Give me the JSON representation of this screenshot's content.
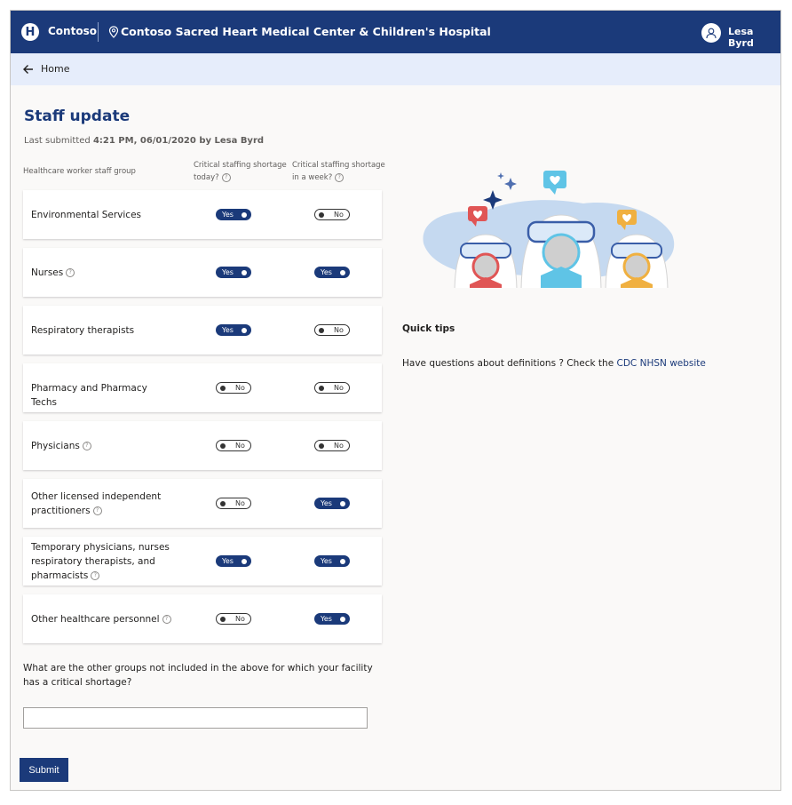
{
  "header": {
    "logo_letter": "H",
    "brand": "Contoso",
    "hospital": "Contoso Sacred Heart Medical Center & Children's Hospital",
    "user": "Lesa Byrd"
  },
  "subnav": {
    "home_label": "Home"
  },
  "page": {
    "title": "Staff update",
    "last_submitted_prefix": "Last submitted ",
    "last_submitted_value": "4:21 PM, 06/01/2020 by Lesa Byrd"
  },
  "columns": {
    "group": "Healthcare worker staff group",
    "today_line1": "Critical staffing shortage",
    "today_line2": "today?",
    "week_line1": "Critical staffing shortage",
    "week_line2": "in a week?"
  },
  "toggle_labels": {
    "on": "Yes",
    "off": "No"
  },
  "rows": [
    {
      "lines": [
        "Environmental Services"
      ],
      "help": false,
      "today": true,
      "week": false
    },
    {
      "lines": [
        "Nurses"
      ],
      "help": true,
      "today": true,
      "week": true
    },
    {
      "lines": [
        "Respiratory therapists"
      ],
      "help": false,
      "today": true,
      "week": false
    },
    {
      "lines": [
        "Pharmacy and Pharmacy Techs"
      ],
      "help": false,
      "today": false,
      "week": false
    },
    {
      "lines": [
        "Physicians"
      ],
      "help": true,
      "today": false,
      "week": false
    },
    {
      "lines": [
        "Other licensed independent",
        "practitioners"
      ],
      "help": true,
      "today": false,
      "week": true
    },
    {
      "lines": [
        "Temporary physicians, nurses",
        "respiratory therapists, and",
        "pharmacists"
      ],
      "help": true,
      "today": true,
      "week": true
    },
    {
      "lines": [
        "Other healthcare personnel"
      ],
      "help": true,
      "today": false,
      "week": true
    }
  ],
  "question": "What are the other groups not included in the above for which your facility has a critical shortage?",
  "other_groups_value": "",
  "submit_label": "Submit",
  "tips": {
    "title": "Quick tips",
    "text": "Have questions about definitions ? Check the ",
    "link": "CDC NHSN website"
  },
  "help_glyph": "?",
  "colors": {
    "primary": "#1b3a7a",
    "subnav": "#e6edfb",
    "page_bg": "#faf9f8"
  }
}
